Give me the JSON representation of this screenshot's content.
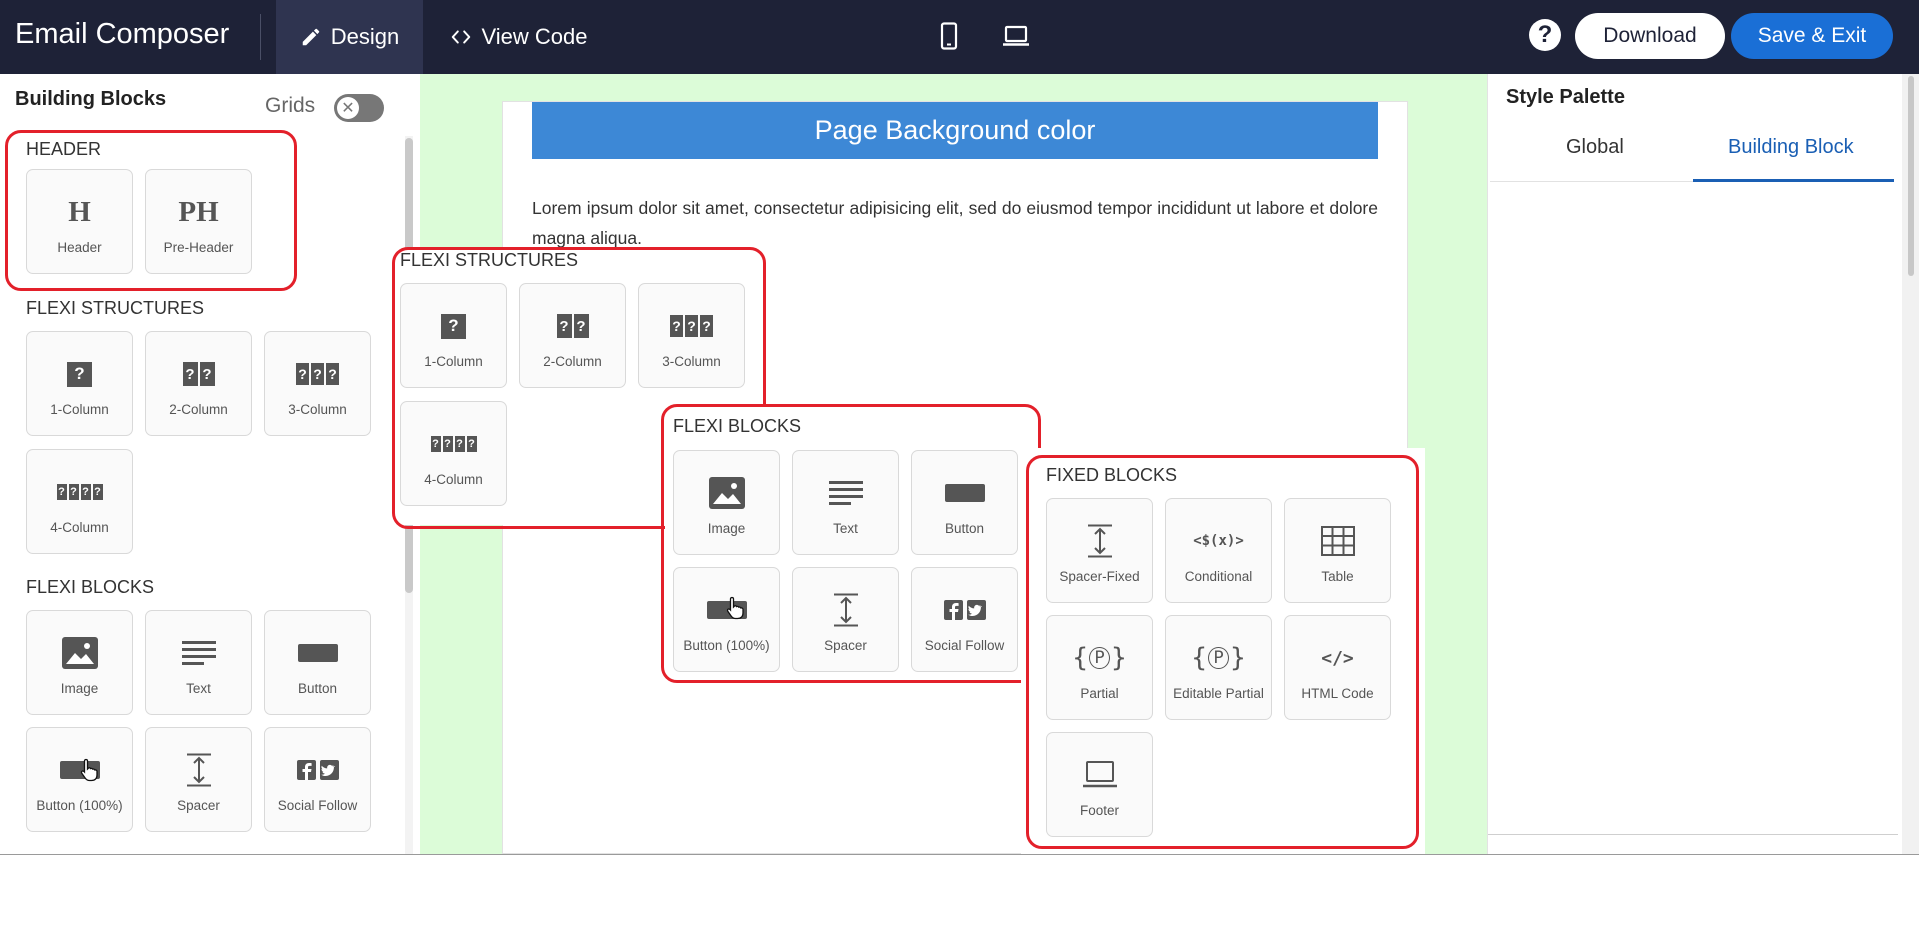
{
  "app": {
    "title": "Email Composer",
    "tabs": {
      "design": "Design",
      "view_code": "View Code"
    },
    "help": "?",
    "download": "Download",
    "save_exit": "Save & Exit"
  },
  "sidebar": {
    "title": "Building Blocks",
    "grids_label": "Grids",
    "grids_toggle_symbol": "✕",
    "header_section": {
      "heading": "HEADER",
      "tiles": [
        {
          "glyph": "H",
          "label": "Header"
        },
        {
          "glyph": "PH",
          "label": "Pre-Header"
        }
      ]
    },
    "structures_section": {
      "heading": "FLEXI STRUCTURES",
      "tiles": [
        {
          "label": "1-Column"
        },
        {
          "label": "2-Column"
        },
        {
          "label": "3-Column"
        },
        {
          "label": "4-Column"
        }
      ]
    },
    "blocks_section": {
      "heading": "FLEXI BLOCKS",
      "tiles": [
        {
          "label": "Image"
        },
        {
          "label": "Text"
        },
        {
          "label": "Button"
        },
        {
          "label": "Button (100%)"
        },
        {
          "label": "Spacer"
        },
        {
          "label": "Social Follow"
        }
      ]
    }
  },
  "canvas": {
    "banner": "Page Background color",
    "body_text": "Lorem ipsum dolor sit amet, consectetur adipisicing elit, sed do eiusmod tempor incididunt ut labore et dolore magna aliqua."
  },
  "popup_structures": {
    "heading": "FLEXI STRUCTURES",
    "tiles": [
      {
        "label": "1-Column"
      },
      {
        "label": "2-Column"
      },
      {
        "label": "3-Column"
      },
      {
        "label": "4-Column"
      }
    ]
  },
  "popup_blocks": {
    "heading": "FLEXI BLOCKS",
    "tiles": [
      {
        "label": "Image"
      },
      {
        "label": "Text"
      },
      {
        "label": "Button"
      },
      {
        "label": "Button (100%)"
      },
      {
        "label": "Spacer"
      },
      {
        "label": "Social Follow"
      }
    ]
  },
  "popup_fixed": {
    "heading": "FIXED BLOCKS",
    "conditional_glyph": "<$(x)>",
    "html_code_glyph": "</>",
    "partial_glyph": "P",
    "tiles": [
      {
        "label": "Spacer-Fixed"
      },
      {
        "label": "Conditional"
      },
      {
        "label": "Table"
      },
      {
        "label": "Partial"
      },
      {
        "label": "Editable Partial"
      },
      {
        "label": "HTML Code"
      },
      {
        "label": "Footer"
      }
    ]
  },
  "style_palette": {
    "title": "Style Palette",
    "tabs": [
      {
        "label": "Global"
      },
      {
        "label": "Building Block",
        "active": true
      }
    ]
  },
  "colors": {
    "topbar": "#1e2237",
    "primary": "#1a6fd6",
    "canvas_bg": "#dcfcd8",
    "banner": "#3d88d6",
    "highlight": "#e3202a"
  }
}
